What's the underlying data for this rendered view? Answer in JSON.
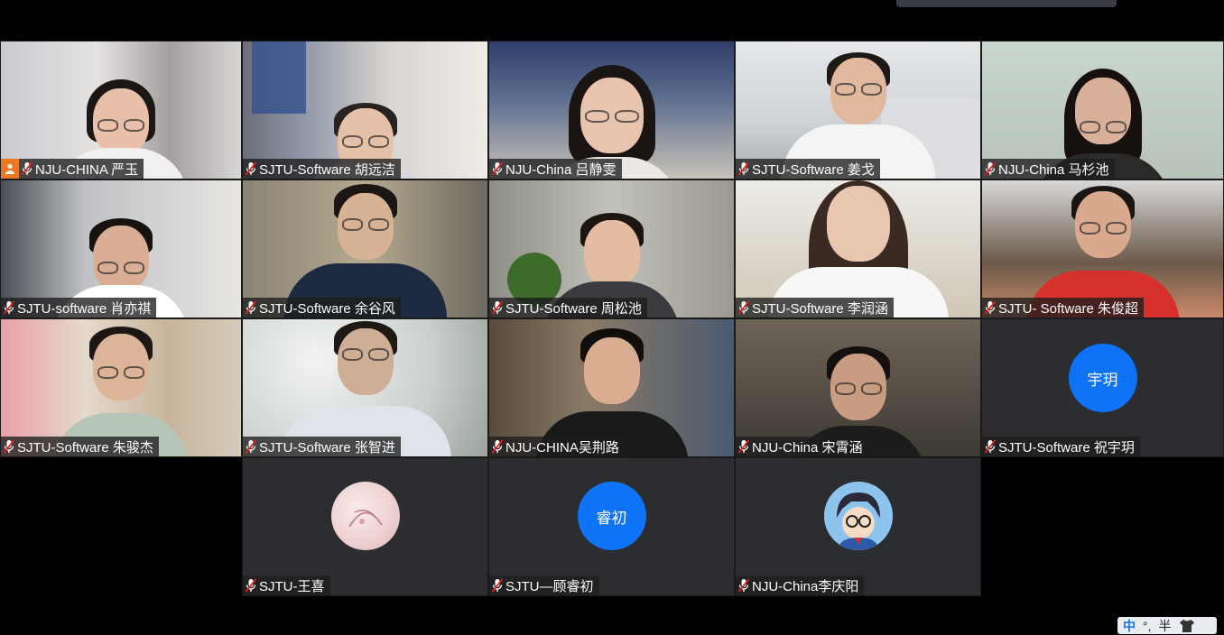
{
  "participants": [
    {
      "name": "NJU-CHINA 严玉",
      "video": true,
      "host": true
    },
    {
      "name": "SJTU-Software 胡远洁",
      "video": true
    },
    {
      "name": "NJU-China 吕静雯",
      "video": true
    },
    {
      "name": "SJTU-Software 姜戈",
      "video": true
    },
    {
      "name": "NJU-China 马杉池",
      "video": true
    },
    {
      "name": "SJTU-software 肖亦祺",
      "video": true
    },
    {
      "name": "SJTU-Software 余谷风",
      "video": true
    },
    {
      "name": "SJTU-Software 周松池",
      "video": true
    },
    {
      "name": "SJTU-Software 李润涵",
      "video": true
    },
    {
      "name": "SJTU- Software 朱俊超",
      "video": true
    },
    {
      "name": "SJTU-Software 朱骏杰",
      "video": true
    },
    {
      "name": "SJTU-Software 张智进",
      "video": true
    },
    {
      "name": "NJU-CHINA吴荆路",
      "video": true
    },
    {
      "name": "NJU-China 宋霄涵",
      "video": true
    },
    {
      "name": "SJTU-Software 祝宇玥",
      "video": false,
      "avatar_text": "宇玥"
    },
    {
      "name": "SJTU-王喜",
      "video": false,
      "avatar_text": ""
    },
    {
      "name": "SJTU—顾睿初",
      "video": false,
      "avatar_text": "睿初"
    },
    {
      "name": "NJU-China李庆阳",
      "video": false,
      "avatar_text": ""
    }
  ],
  "ime": {
    "mode": "中",
    "punct": "°,",
    "width": "半",
    "icon": "shirt-icon"
  },
  "colors": {
    "host_badge": "#f07820",
    "avatar_blue": "#0e73f6",
    "label_bg": "rgba(30,30,30,0.78)"
  }
}
